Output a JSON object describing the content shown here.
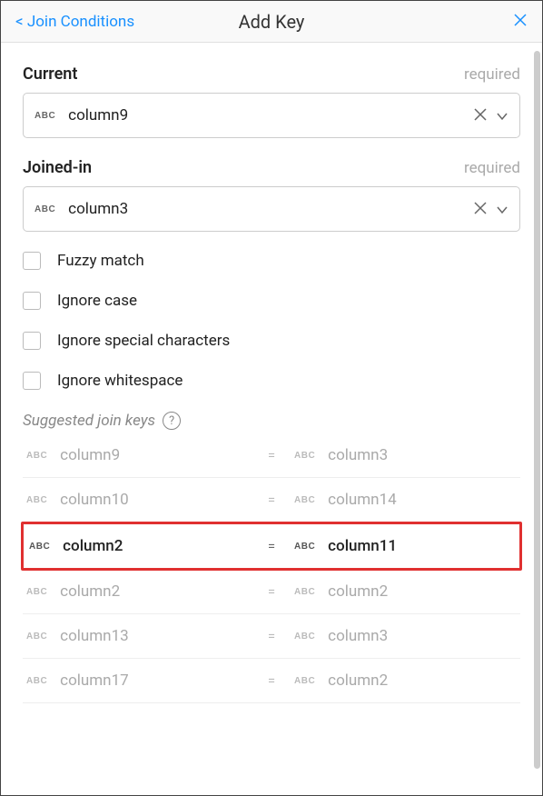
{
  "header": {
    "back_label": "< Join Conditions",
    "title": "Add Key"
  },
  "fields": {
    "current": {
      "label": "Current",
      "required": "required",
      "value": "column9"
    },
    "joined": {
      "label": "Joined-in",
      "required": "required",
      "value": "column3"
    }
  },
  "abc": "ABC",
  "checkboxes": {
    "fuzzy": "Fuzzy match",
    "ignore_case": "Ignore case",
    "ignore_special": "Ignore special characters",
    "ignore_ws": "Ignore whitespace"
  },
  "suggested_label": "Suggested join keys",
  "help_q": "?",
  "equals": "=",
  "suggestions": [
    {
      "left": "column9",
      "right": "column3",
      "highlighted": false
    },
    {
      "left": "column10",
      "right": "column14",
      "highlighted": false
    },
    {
      "left": "column2",
      "right": "column11",
      "highlighted": true
    },
    {
      "left": "column2",
      "right": "column2",
      "highlighted": false
    },
    {
      "left": "column13",
      "right": "column3",
      "highlighted": false
    },
    {
      "left": "column17",
      "right": "column2",
      "highlighted": false
    }
  ]
}
